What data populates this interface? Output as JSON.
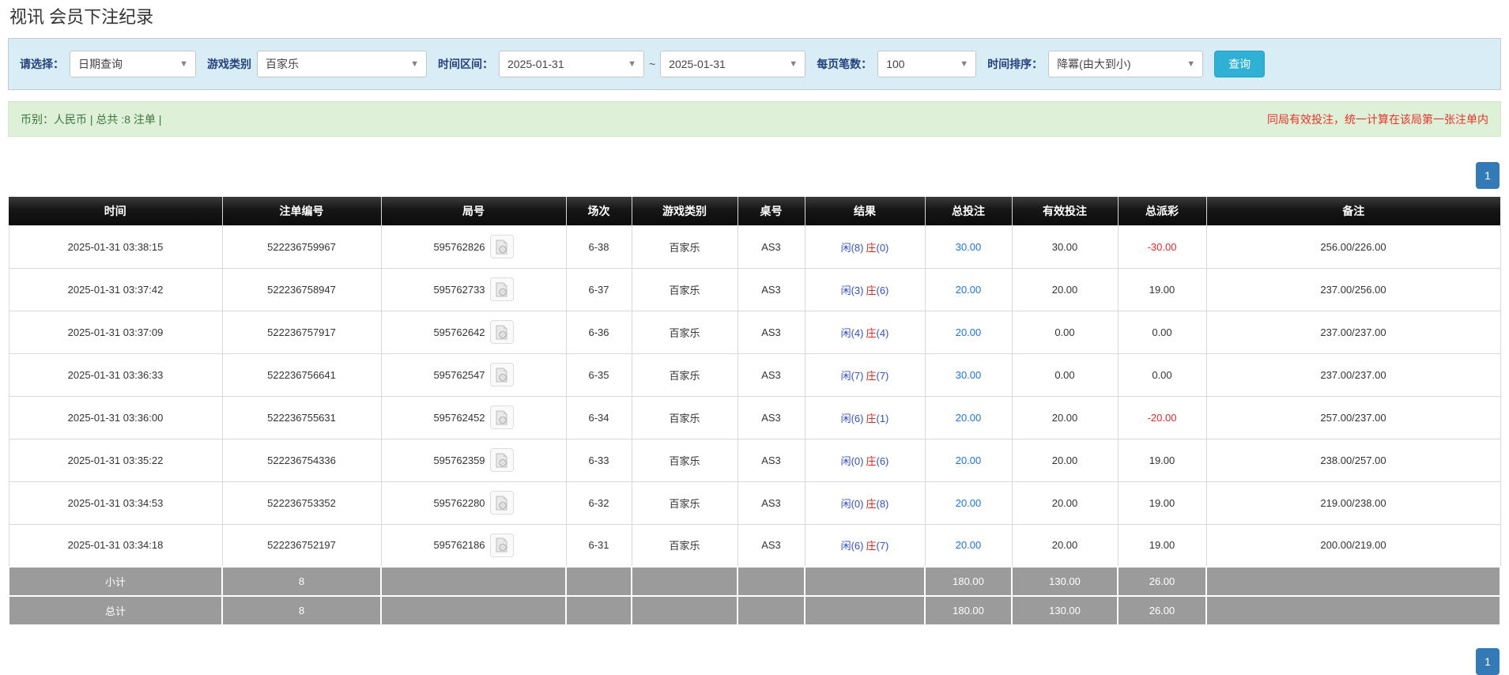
{
  "page": {
    "title": "视讯 会员下注纪录"
  },
  "filters": {
    "query_type_label": "请选择：",
    "query_type_value": "日期查询",
    "game_type_label": "游戏类别",
    "game_type_value": "百家乐",
    "time_range_label": "时间区间：",
    "date_from": "2025-01-31",
    "tilde": "~",
    "date_to": "2025-01-31",
    "per_page_label": "每页笔数：",
    "per_page_value": "100",
    "sort_label": "时间排序：",
    "sort_value": "降冪(由大到小)",
    "search_button_label": "查询"
  },
  "summary": {
    "left_text": "币别：人民币 | 总共 :8 注单 |",
    "right_text": "同局有效投注，统一计算在该局第一张注单内"
  },
  "pagination": {
    "current_page": "1"
  },
  "table": {
    "headers": [
      "时间",
      "注单编号",
      "局号",
      "场次",
      "游戏类别",
      "桌号",
      "结果",
      "总投注",
      "有效投注",
      "总派彩",
      "备注"
    ],
    "rows": [
      {
        "time": "2025-01-31 03:38:15",
        "bet_id": "522236759967",
        "round_id": "595762826",
        "session": "6-38",
        "game": "百家乐",
        "table_no": "AS3",
        "result": {
          "player": "闲(8)",
          "banker_char": "庄",
          "banker_num": "(0)"
        },
        "total_bet": "30.00",
        "valid_bet": "30.00",
        "payout": "-30.00",
        "remark": "256.00/226.00"
      },
      {
        "time": "2025-01-31 03:37:42",
        "bet_id": "522236758947",
        "round_id": "595762733",
        "session": "6-37",
        "game": "百家乐",
        "table_no": "AS3",
        "result": {
          "player": "闲(3)",
          "banker_char": "庄",
          "banker_num": "(6)"
        },
        "total_bet": "20.00",
        "valid_bet": "20.00",
        "payout": "19.00",
        "remark": "237.00/256.00"
      },
      {
        "time": "2025-01-31 03:37:09",
        "bet_id": "522236757917",
        "round_id": "595762642",
        "session": "6-36",
        "game": "百家乐",
        "table_no": "AS3",
        "result": {
          "player": "闲(4)",
          "banker_char": "庄",
          "banker_num": "(4)"
        },
        "total_bet": "20.00",
        "valid_bet": "0.00",
        "payout": "0.00",
        "remark": "237.00/237.00"
      },
      {
        "time": "2025-01-31 03:36:33",
        "bet_id": "522236756641",
        "round_id": "595762547",
        "session": "6-35",
        "game": "百家乐",
        "table_no": "AS3",
        "result": {
          "player": "闲(7)",
          "banker_char": "庄",
          "banker_num": "(7)"
        },
        "total_bet": "30.00",
        "valid_bet": "0.00",
        "payout": "0.00",
        "remark": "237.00/237.00"
      },
      {
        "time": "2025-01-31 03:36:00",
        "bet_id": "522236755631",
        "round_id": "595762452",
        "session": "6-34",
        "game": "百家乐",
        "table_no": "AS3",
        "result": {
          "player": "闲(6)",
          "banker_char": "庄",
          "banker_num": "(1)"
        },
        "total_bet": "20.00",
        "valid_bet": "20.00",
        "payout": "-20.00",
        "remark": "257.00/237.00"
      },
      {
        "time": "2025-01-31 03:35:22",
        "bet_id": "522236754336",
        "round_id": "595762359",
        "session": "6-33",
        "game": "百家乐",
        "table_no": "AS3",
        "result": {
          "player": "闲(0)",
          "banker_char": "庄",
          "banker_num": "(6)"
        },
        "total_bet": "20.00",
        "valid_bet": "20.00",
        "payout": "19.00",
        "remark": "238.00/257.00"
      },
      {
        "time": "2025-01-31 03:34:53",
        "bet_id": "522236753352",
        "round_id": "595762280",
        "session": "6-32",
        "game": "百家乐",
        "table_no": "AS3",
        "result": {
          "player": "闲(0)",
          "banker_char": "庄",
          "banker_num": "(8)"
        },
        "total_bet": "20.00",
        "valid_bet": "20.00",
        "payout": "19.00",
        "remark": "219.00/238.00"
      },
      {
        "time": "2025-01-31 03:34:18",
        "bet_id": "522236752197",
        "round_id": "595762186",
        "session": "6-31",
        "game": "百家乐",
        "table_no": "AS3",
        "result": {
          "player": "闲(6)",
          "banker_char": "庄",
          "banker_num": "(7)"
        },
        "total_bet": "20.00",
        "valid_bet": "20.00",
        "payout": "19.00",
        "remark": "200.00/219.00"
      }
    ],
    "subtotal": {
      "label": "小计",
      "count": "8",
      "total_bet": "180.00",
      "valid_bet": "130.00",
      "payout": "26.00"
    },
    "total": {
      "label": "总计",
      "count": "8",
      "total_bet": "180.00",
      "valid_bet": "130.00",
      "payout": "26.00"
    }
  },
  "icons": {
    "dropdown_arrow": "chevron-down-icon",
    "video_file": "video-file-icon"
  },
  "colors": {
    "filter_bg": "#d9edf7",
    "filter_label": "#25417e",
    "search_button": "#31b0d5",
    "summary_bg": "#dff0d8",
    "summary_text_green": "#3c763d",
    "summary_text_red": "#e8332a",
    "header_bg": "#161616",
    "footer_bg": "#9b9b9b",
    "pagination_bg": "#337ab7",
    "bet_link_blue": "#1a73e8",
    "result_blue": "#3350c0",
    "result_red": "#d9251f",
    "payout_negative_red": "#e8252a"
  }
}
